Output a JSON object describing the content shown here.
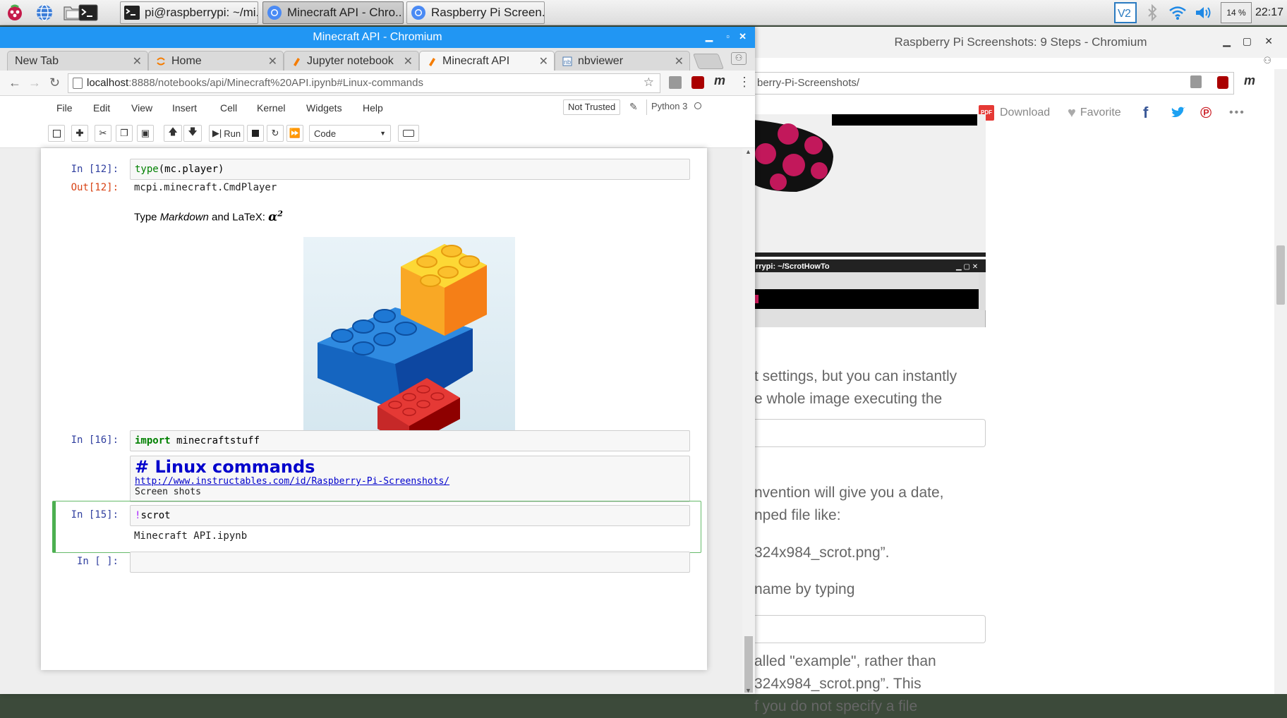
{
  "taskbar": {
    "tasks": [
      {
        "label": "pi@raspberrypi: ~/mi..."
      },
      {
        "label": "Minecraft API - Chro..."
      },
      {
        "label": "Raspberry Pi Screen..."
      }
    ],
    "cpu": "14 %",
    "clock": "22:17"
  },
  "background_window": {
    "title": "Raspberry Pi Screenshots: 9 Steps - Chromium",
    "address": "berry-Pi-Screenshots/",
    "actions": {
      "download": "Download",
      "favorite": "Favorite",
      "more": "•••"
    },
    "terminal_title": "rrypi: ~/ScrotHowTo",
    "paragraphs": [
      "t settings, but you can instantly",
      "e whole image executing the",
      "nvention will give you a date,",
      "nped file like:",
      "324x984_scrot.png”.",
      "name by typing",
      "alled \"example\", rather than",
      "324x984_scrot.png”. This",
      "f you do not specify a file"
    ]
  },
  "main_window": {
    "title": "Minecraft API - Chromium",
    "tabs": [
      {
        "label": "New Tab"
      },
      {
        "label": "Home"
      },
      {
        "label": "Jupyter notebook"
      },
      {
        "label": "Minecraft API"
      },
      {
        "label": "nbviewer"
      }
    ],
    "url_host": "localhost",
    "url_rest": ":8888/notebooks/api/Minecraft%20API.ipynb#Linux-commands"
  },
  "jupyter": {
    "menu": [
      "File",
      "Edit",
      "View",
      "Insert",
      "Cell",
      "Kernel",
      "Widgets",
      "Help"
    ],
    "trust": "Not Trusted",
    "kernel": "Python 3",
    "run_label": "Run",
    "cell_type": "Code",
    "cells": {
      "c12_prompt_in": "In [12]:",
      "c12_code_fn": "type",
      "c12_code_rest": "(mc.player)",
      "c12_prompt_out": "Out[12]:",
      "c12_output": "mcpi.minecraft.CmdPlayer",
      "md_prefix": "Type ",
      "md_em": "Markdown",
      "md_mid": " and LaTeX: ",
      "md_math": "α",
      "md_sup": "2",
      "c16_prompt": "In [16]:",
      "c16_kw": "import",
      "c16_rest": " minecraftstuff",
      "raw_heading": "# Linux commands",
      "raw_link": "http://www.instructables.com/id/Raspberry-Pi-Screenshots/",
      "raw_text": "Screen shots",
      "c15_prompt": "In [15]:",
      "c15_bang": "!",
      "c15_rest": "scrot",
      "c15_output": "Minecraft API.ipynb",
      "empty_prompt": "In [ ]:"
    }
  }
}
